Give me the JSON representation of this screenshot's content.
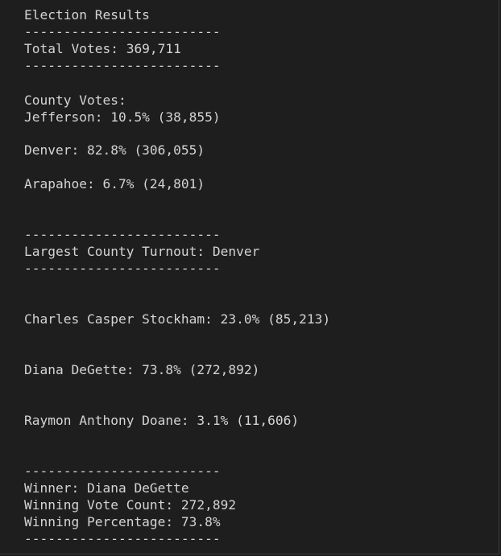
{
  "report": {
    "title": "Election Results",
    "divider": "-------------------------",
    "total_votes": "Total Votes: 369,711",
    "county_header": "County Votes:",
    "counties": [
      "Jefferson: 10.5% (38,855)",
      "Denver: 82.8% (306,055)",
      "Arapahoe: 6.7% (24,801)"
    ],
    "largest_county": "Largest County Turnout: Denver",
    "candidates": [
      "Charles Casper Stockham: 23.0% (85,213)",
      "Diana DeGette: 73.8% (272,892)",
      "Raymon Anthony Doane: 3.1% (11,606)"
    ],
    "winner": "Winner: Diana DeGette",
    "winning_count": "Winning Vote Count: 272,892",
    "winning_percentage": "Winning Percentage: 73.8%"
  }
}
